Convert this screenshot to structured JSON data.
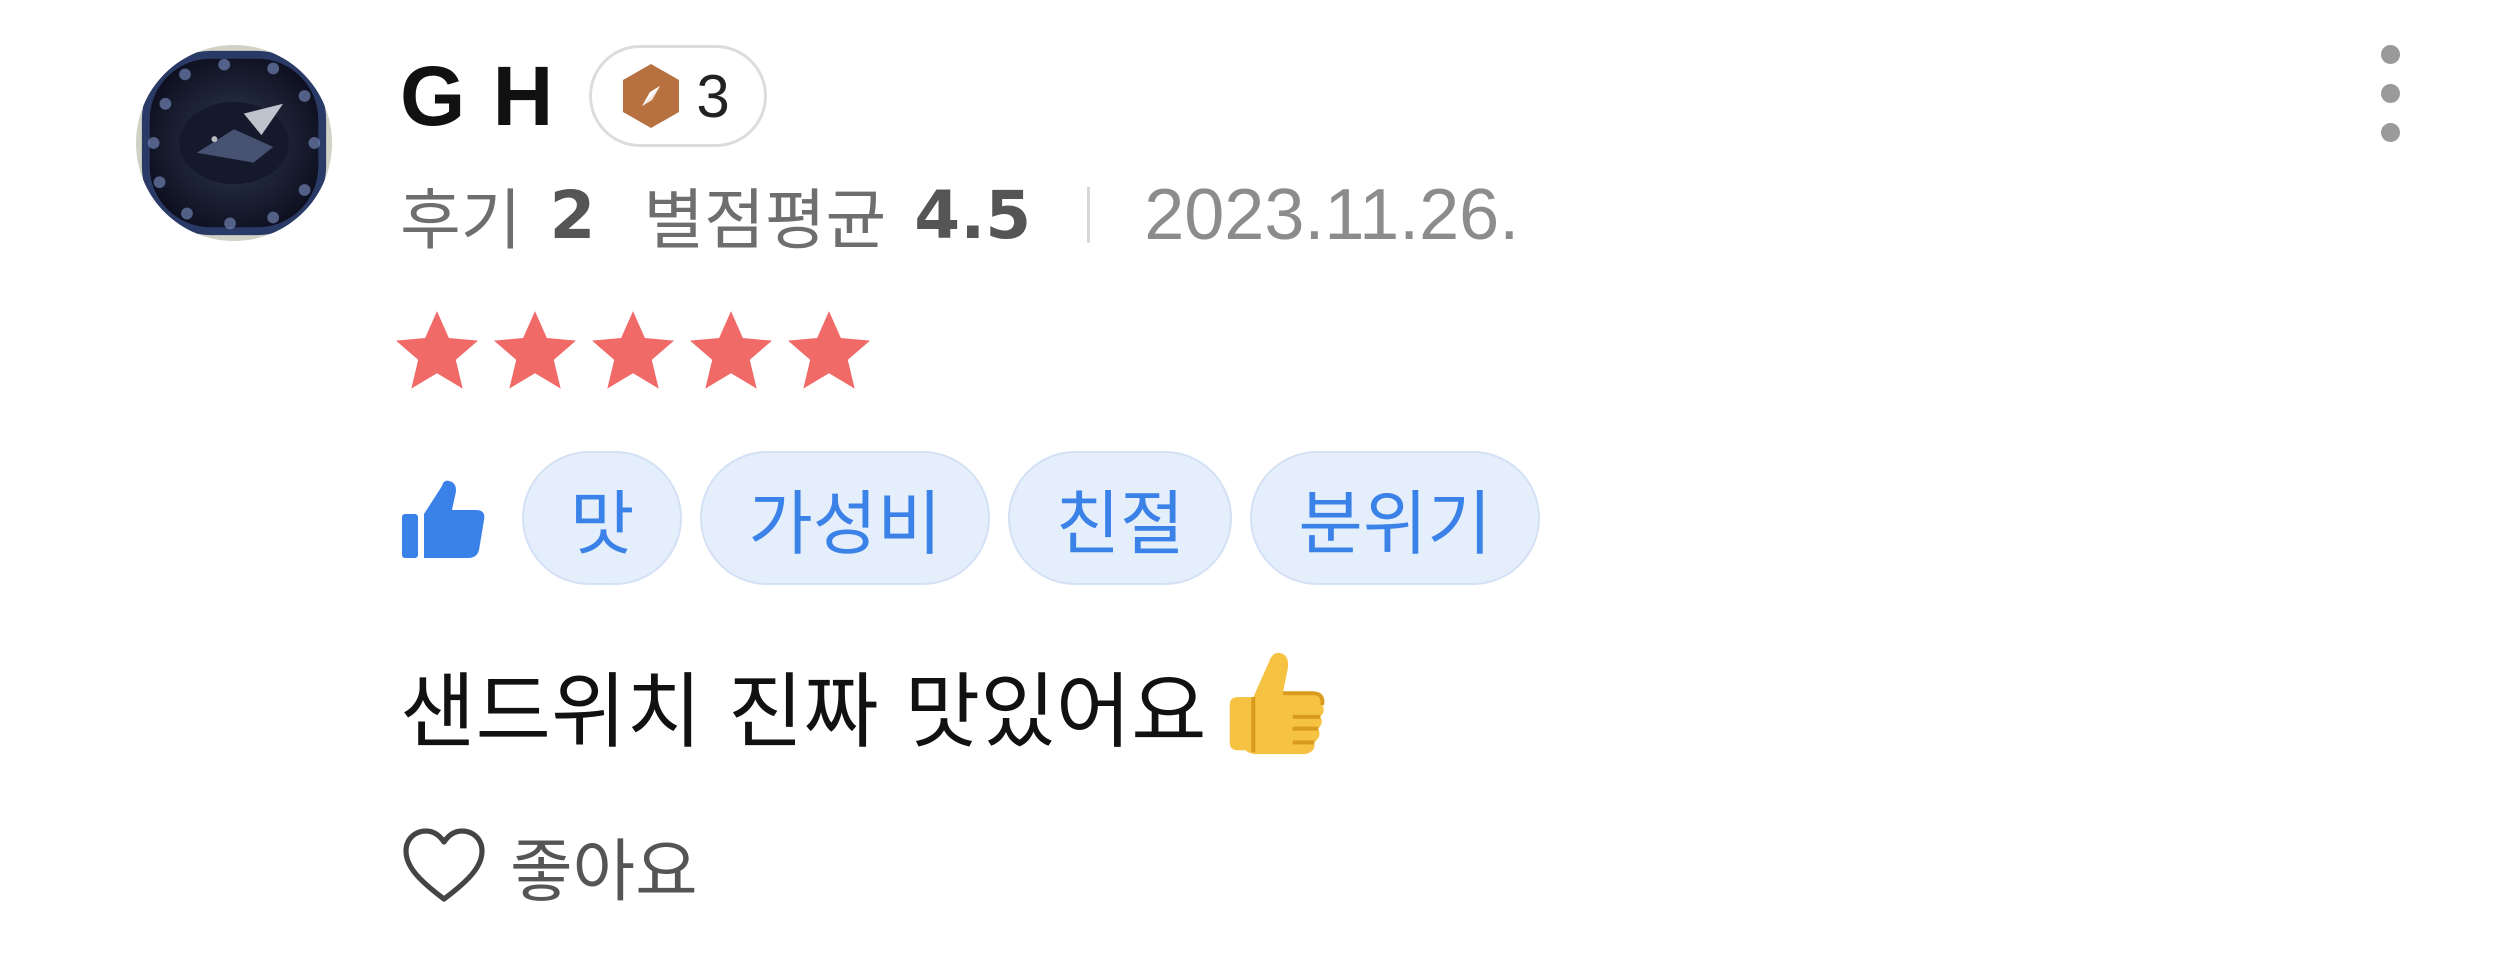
{
  "review": {
    "author": {
      "name": "G H",
      "level": "3"
    },
    "meta": {
      "review_count_label": "후기",
      "review_count": "2",
      "avg_rating_label": "별점평균",
      "avg_rating": "4.5",
      "date": "2023.11.26."
    },
    "rating": 5,
    "star_color": "#f06a68",
    "tags": [
      "맛",
      "가성비",
      "친절",
      "분위기"
    ],
    "tag_color": "#3a82e8",
    "tag_bg": "#e5eefb",
    "text": "샌드위치 진짜 맛있어요",
    "emoji_icon": "thumbs-up-emoji",
    "like_label": "좋아요",
    "icons": {
      "more": "more-vertical-icon",
      "tag_prefix": "thumbs-up-icon",
      "like": "heart-outline-icon",
      "badge": "compass-hexagon-icon"
    }
  }
}
